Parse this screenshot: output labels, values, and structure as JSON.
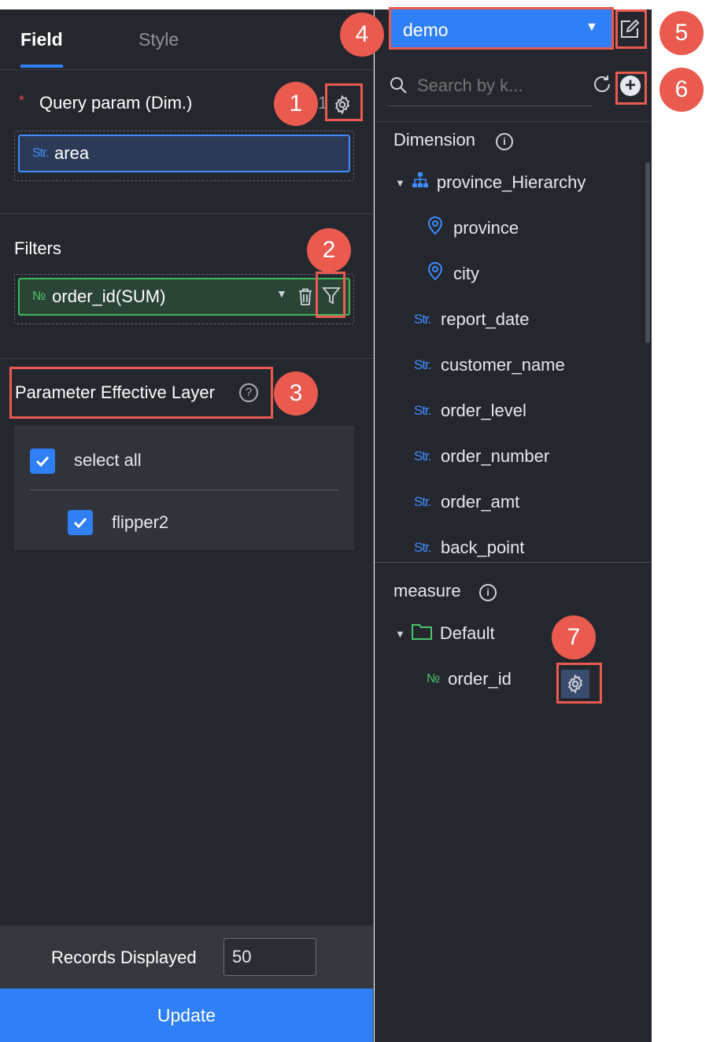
{
  "tabs": {
    "field": "Field",
    "style": "Style"
  },
  "query_param": {
    "title": "Query param (Dim.)",
    "required_mark": "*",
    "count": "1",
    "field": {
      "type": "Str.",
      "name": "area"
    }
  },
  "filters": {
    "title": "Filters",
    "field": {
      "type": "№",
      "name": "order_id(SUM)"
    }
  },
  "effective_layer": {
    "title": "Parameter Effective Layer",
    "select_all": {
      "label": "select all",
      "checked": true
    },
    "items": [
      {
        "label": "flipper2",
        "checked": true
      }
    ]
  },
  "records": {
    "label": "Records Displayed",
    "value": "50"
  },
  "update_label": "Update",
  "dataset": {
    "selected": "demo"
  },
  "search": {
    "placeholder": "Search by k..."
  },
  "dimension": {
    "title": "Dimension",
    "hierarchy": {
      "name": "province_Hierarchy",
      "children": [
        {
          "name": "province",
          "icon": "location-icon"
        },
        {
          "name": "city",
          "icon": "location-icon"
        }
      ]
    },
    "fields": [
      {
        "type": "Str.",
        "name": "report_date"
      },
      {
        "type": "Str.",
        "name": "customer_name"
      },
      {
        "type": "Str.",
        "name": "order_level"
      },
      {
        "type": "Str.",
        "name": "order_number"
      },
      {
        "type": "Str.",
        "name": "order_amt"
      },
      {
        "type": "Str.",
        "name": "back_point"
      }
    ]
  },
  "measure": {
    "title": "measure",
    "folder": "Default",
    "fields": [
      {
        "type": "№",
        "name": "order_id"
      }
    ]
  },
  "badges": [
    "1",
    "2",
    "3",
    "4",
    "5",
    "6",
    "7"
  ],
  "colors": {
    "accent": "#2f7ff6",
    "panel": "#24272e",
    "highlight": "#ea5a4f",
    "str_tag": "#3f8cff",
    "num_tag": "#4cc46a"
  }
}
